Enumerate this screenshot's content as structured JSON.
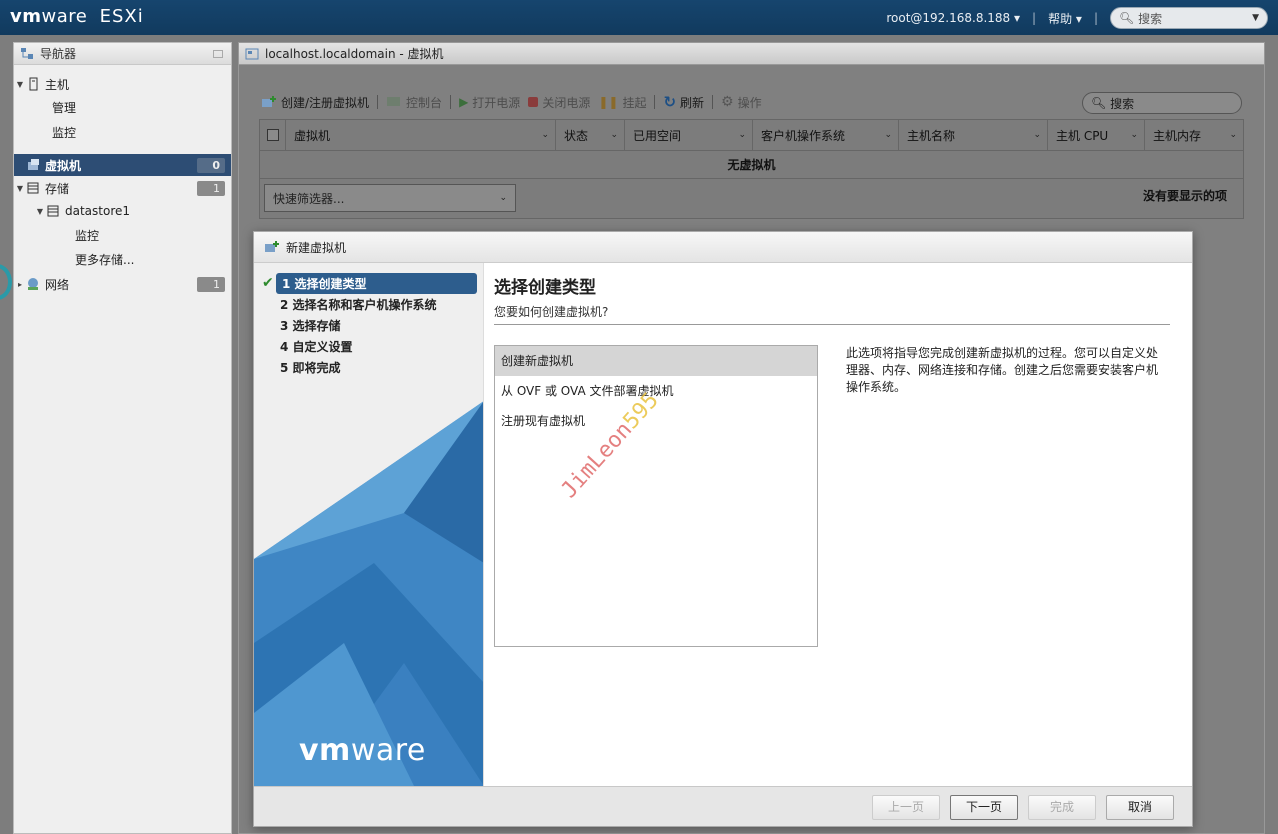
{
  "app": {
    "logo_vm": "vm",
    "logo_ware": "ware",
    "logo_product": "ESXi",
    "user": "root@192.168.8.188",
    "help": "帮助",
    "search_placeholder": "搜索"
  },
  "navigator": {
    "title": "导航器",
    "host": "主机",
    "manage": "管理",
    "monitor": "监控",
    "vms": "虚拟机",
    "vms_count": "0",
    "storage": "存储",
    "storage_count": "1",
    "datastore": "datastore1",
    "ds_monitor": "监控",
    "more_storage": "更多存储...",
    "network": "网络",
    "network_count": "1"
  },
  "main": {
    "title": "localhost.localdomain - 虚拟机",
    "toolbar": {
      "create": "创建/注册虚拟机",
      "console": "控制台",
      "power_on": "打开电源",
      "power_off": "关闭电源",
      "suspend": "挂起",
      "refresh": "刷新",
      "actions": "操作"
    },
    "search_placeholder": "搜索",
    "columns": [
      "虚拟机",
      "状态",
      "已用空间",
      "客户机操作系统",
      "主机名称",
      "主机 CPU",
      "主机内存"
    ],
    "empty": "无虚拟机",
    "quick_filter": "快速筛选器...",
    "no_items": "没有要显示的项"
  },
  "dialog": {
    "title": "新建虚拟机",
    "steps": [
      "1 选择创建类型",
      "2 选择名称和客户机操作系统",
      "3 选择存储",
      "4 自定义设置",
      "5 即将完成"
    ],
    "heading": "选择创建类型",
    "subheading": "您要如何创建虚拟机?",
    "types": [
      "创建新虚拟机",
      "从 OVF 或 OVA 文件部署虚拟机",
      "注册现有虚拟机"
    ],
    "description": "此选项将指导您完成创建新虚拟机的过程。您可以自定义处理器、内存、网络连接和存储。创建之后您需要安装客户机操作系统。",
    "watermark_a": "JimLeon",
    "watermark_b": "595",
    "side_logo_vm": "vm",
    "side_logo_ware": "ware",
    "buttons": {
      "back": "上一页",
      "next": "下一页",
      "finish": "完成",
      "cancel": "取消"
    }
  },
  "colors": {
    "topbar": "#16456e",
    "selected_nav": "#2d4d74",
    "active_step": "#2d5d8d"
  }
}
